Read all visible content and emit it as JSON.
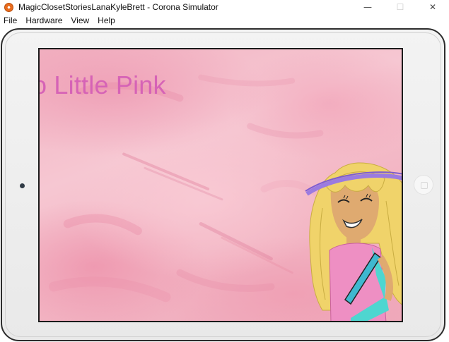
{
  "window": {
    "title": "MagicClosetStoriesLanaKyleBrett - Corona Simulator",
    "controls": {
      "minimize": "—",
      "maximize": "☐",
      "close": "✕"
    }
  },
  "menu": {
    "items": [
      "File",
      "Hardware",
      "View",
      "Help"
    ]
  },
  "screen": {
    "title_text": "o Little Pink"
  },
  "colors": {
    "title_text": "#d663b6",
    "background_pink": "#f2b3c2",
    "hair": "#f0d36a",
    "headband": "#9b7be0",
    "dress": "#ee8fc3",
    "dress_trim": "#4ed6d0"
  }
}
